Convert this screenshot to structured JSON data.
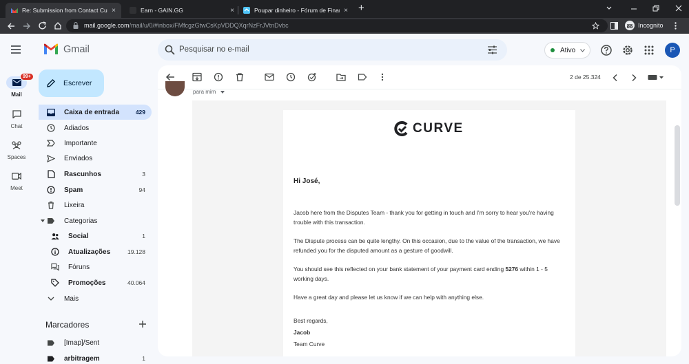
{
  "browser": {
    "tabs": [
      {
        "title": "Re: Submission from Contact Cur",
        "close": "×"
      },
      {
        "title": "Earn - GAIN.GG",
        "close": "×"
      },
      {
        "title": "Poupar dinheiro - Fórum de Finan",
        "close": "×"
      }
    ],
    "new_tab": "+",
    "url_host": "mail.google.com",
    "url_path": "/mail/u/0/#inbox/FMfcgzGtwCsKpVDDQXqrNzFrJVtnDvbc",
    "incognito_label": "Incognito"
  },
  "gmail": {
    "brand": "Gmail",
    "search_placeholder": "Pesquisar no e-mail",
    "status_label": "Ativo",
    "avatar_letter": "P",
    "accent": "#d3e3fd",
    "compose_bg": "#c2e7ff"
  },
  "rail": [
    {
      "label": "Mail",
      "badge": "99+",
      "icon": "mail-icon"
    },
    {
      "label": "Chat",
      "icon": "chat-icon"
    },
    {
      "label": "Spaces",
      "icon": "spaces-icon"
    },
    {
      "label": "Meet",
      "icon": "meet-icon"
    }
  ],
  "compose_label": "Escrever",
  "nav": [
    {
      "label": "Caixa de entrada",
      "count": "429",
      "icon": "inbox-icon"
    },
    {
      "label": "Adiados",
      "count": "",
      "icon": "clock-icon"
    },
    {
      "label": "Importante",
      "count": "",
      "icon": "important-icon"
    },
    {
      "label": "Enviados",
      "count": "",
      "icon": "send-icon"
    },
    {
      "label": "Rascunhos",
      "count": "3",
      "icon": "draft-icon"
    },
    {
      "label": "Spam",
      "count": "94",
      "icon": "spam-icon"
    },
    {
      "label": "Lixeira",
      "count": "",
      "icon": "trash-icon"
    },
    {
      "label": "Categorias",
      "count": "",
      "icon": "label-icon"
    },
    {
      "label": "Social",
      "count": "1",
      "icon": "people-icon"
    },
    {
      "label": "Atualizações",
      "count": "19.128",
      "icon": "info-icon"
    },
    {
      "label": "Fóruns",
      "count": "",
      "icon": "forum-icon"
    },
    {
      "label": "Promoções",
      "count": "40.064",
      "icon": "tag-icon"
    },
    {
      "label": "Mais",
      "count": "",
      "icon": "chevron-down-icon"
    }
  ],
  "labels_title": "Marcadores",
  "labels": [
    {
      "label": "[Imap]/Sent",
      "count": ""
    },
    {
      "label": "arbitragem",
      "count": "1"
    }
  ],
  "message": {
    "pager": "2 de 25.324",
    "to_me": "para mim",
    "brand_wordmark": "CURVE",
    "greeting": "Hi José,",
    "p1": "Jacob here from the Disputes Team - thank you for getting in touch and I'm sorry to hear you're having trouble with this transaction.",
    "p2": "The Dispute process can be quite lengthy. On this occasion, due to the value of the transaction, we have refunded you for the disputed amount as a gesture of goodwill.",
    "p3_a": "You should see this reflected on your bank statement of your payment card ending ",
    "p3_card": "5276",
    "p3_b": " within 1 - 5 working days.",
    "p4": "Have a great day and please let us know if we can help with anything else.",
    "sign_regards": "Best regards,",
    "sign_name": "Jacob",
    "sign_team": "Team Curve"
  }
}
